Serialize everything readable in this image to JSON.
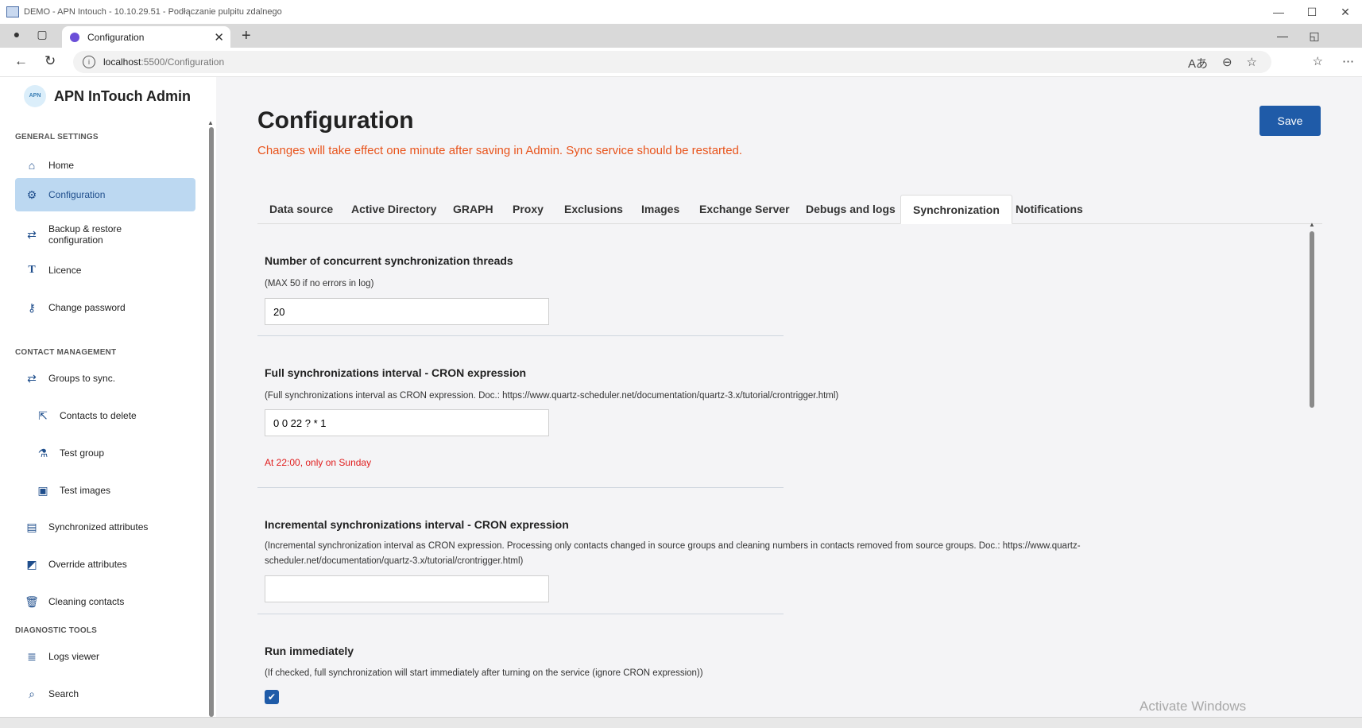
{
  "window": {
    "title": "DEMO - APN Intouch - 10.10.29.51 - Podłączanie pulpitu zdalnego",
    "controls": [
      "—",
      "☐",
      "✕"
    ]
  },
  "browser": {
    "tab_title": "Configuration",
    "tab_close": "✕",
    "new_tab": "+",
    "url_host": "localhost",
    "url_path": ":5500/Configuration",
    "strip_controls": [
      "—",
      "◱",
      "✕"
    ]
  },
  "sidebar": {
    "app_title": "APN InTouch Admin",
    "logo_text": "APN",
    "sections": {
      "general": "GENERAL SETTINGS",
      "contact": "CONTACT MANAGEMENT",
      "diagnostic": "DIAGNOSTIC TOOLS"
    },
    "items": {
      "home": "Home",
      "configuration": "Configuration",
      "backup_line1": "Backup & restore",
      "backup_line2": "configuration",
      "licence": "Licence",
      "change_password": "Change password",
      "groups": "Groups to sync.",
      "contacts_delete": "Contacts to delete",
      "test_group": "Test group",
      "test_images": "Test images",
      "sync_attributes": "Synchronized attributes",
      "override_attributes": "Override attributes",
      "cleaning_contacts": "Cleaning contacts",
      "logs_viewer": "Logs viewer",
      "search": "Search"
    }
  },
  "main": {
    "title": "Configuration",
    "warning": "Changes will take effect one minute after saving in Admin. Sync service should be restarted.",
    "save_label": "Save",
    "tabs": [
      "Data source",
      "Active Directory",
      "GRAPH",
      "Proxy",
      "Exclusions",
      "Images",
      "Exchange Server",
      "Debugs and logs",
      "Synchronization",
      "Notifications"
    ],
    "active_tab": "Synchronization",
    "fields": {
      "threads": {
        "title": "Number of concurrent synchronization threads",
        "help": "(MAX 50 if no errors in log)",
        "value": "20"
      },
      "full_cron": {
        "title": "Full synchronizations interval - CRON expression",
        "help": "(Full synchronizations interval as CRON expression. Doc.: https://www.quartz-scheduler.net/documentation/quartz-3.x/tutorial/crontrigger.html)",
        "value": "0 0 22 ? * 1",
        "note": "At 22:00, only on Sunday"
      },
      "incremental_cron": {
        "title": "Incremental synchronizations interval - CRON expression",
        "help_line1": "(Incremental synchronization interval as CRON expression. Processing only contacts changed in source groups and cleaning numbers in contacts removed from source groups. Doc.: https://www.quartz-",
        "help_line2": "scheduler.net/documentation/quartz-3.x/tutorial/crontrigger.html)",
        "value": ""
      },
      "run_immediately": {
        "title": "Run immediately",
        "help": "(If checked, full synchronization will start immediately after turning on the service (ignore CRON expression))",
        "checked_glyph": "✔"
      }
    },
    "watermark": "Activate Windows"
  }
}
